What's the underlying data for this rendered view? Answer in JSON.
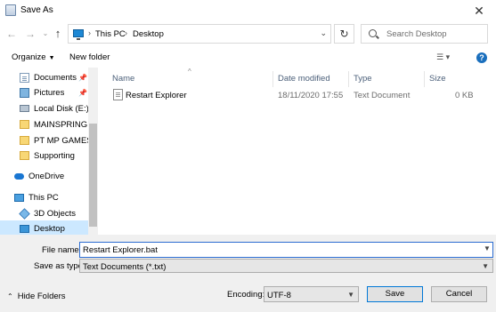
{
  "window": {
    "title": "Save As",
    "close_glyph": "✕"
  },
  "nav": {
    "back_glyph": "←",
    "forward_glyph": "→",
    "recent_glyph": "⌄",
    "up_glyph": "↑",
    "breadcrumb": [
      "This PC",
      "Desktop"
    ],
    "crumb_separator": "›",
    "refresh_glyph": "↻",
    "search_placeholder": "Search Desktop"
  },
  "toolbar": {
    "organize_label": "Organize",
    "new_folder_label": "New folder",
    "help_glyph": "?"
  },
  "sidebar": {
    "items": [
      {
        "label": "Documents",
        "icon": "documents-icon",
        "pinned": true
      },
      {
        "label": "Pictures",
        "icon": "pictures-icon",
        "pinned": true
      },
      {
        "label": "Local Disk (E:)",
        "icon": "disk-icon",
        "pinned": false
      },
      {
        "label": "MAINSPRING TE",
        "icon": "folder-icon",
        "pinned": false
      },
      {
        "label": "PT MP GAMES",
        "icon": "folder-icon",
        "pinned": false
      },
      {
        "label": "Supporting",
        "icon": "folder-icon",
        "pinned": false
      },
      {
        "label": "OneDrive",
        "icon": "onedrive-icon",
        "pinned": false
      },
      {
        "label": "This PC",
        "icon": "pc-icon",
        "pinned": false
      },
      {
        "label": "3D Objects",
        "icon": "3d-objects-icon",
        "pinned": false
      },
      {
        "label": "Desktop",
        "icon": "desktop-icon",
        "pinned": false,
        "selected": true
      }
    ],
    "pin_glyph": "📌"
  },
  "filelist": {
    "columns": [
      "Name",
      "Date modified",
      "Type",
      "Size"
    ],
    "sort_glyph": "^",
    "rows": [
      {
        "name": "Restart Explorer",
        "date": "18/11/2020 17:55",
        "type": "Text Document",
        "size": "0 KB"
      }
    ]
  },
  "form": {
    "file_name_label": "File name:",
    "file_name_value": "Restart Explorer.bat",
    "save_as_type_label": "Save as type:",
    "save_as_type_value": "Text Documents (*.txt)",
    "hide_folders_label": "Hide Folders",
    "encoding_label": "Encoding:",
    "encoding_value": "UTF-8",
    "save_label": "Save",
    "cancel_label": "Cancel"
  },
  "colors": {
    "accent": "#0078d7",
    "selection": "#cce8ff",
    "panel": "#f0f0f0"
  }
}
